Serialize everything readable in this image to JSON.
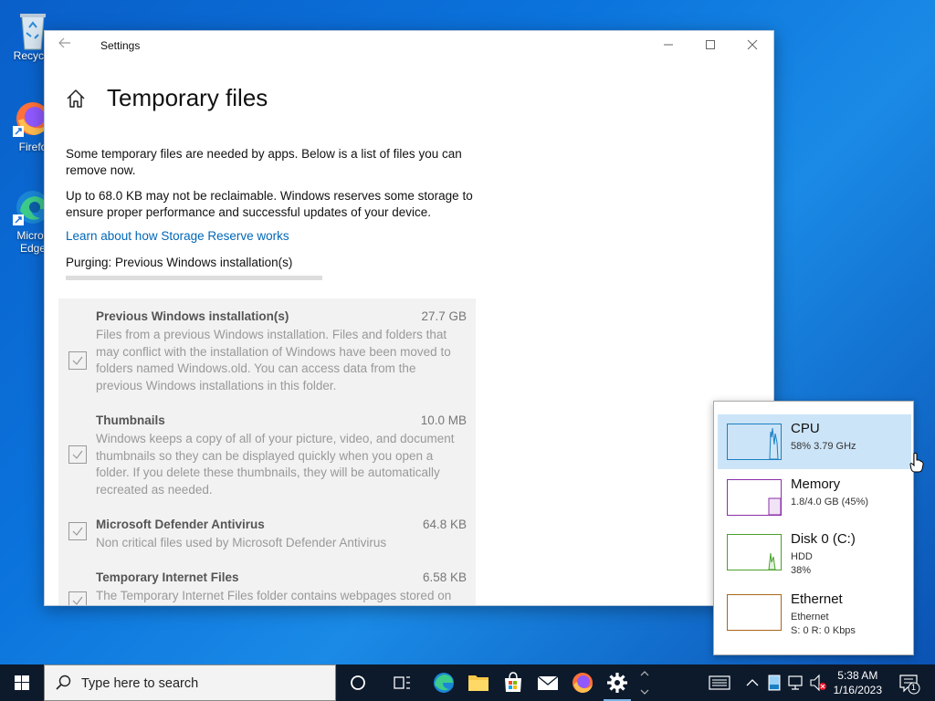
{
  "desktop": {
    "icons": [
      {
        "label": "Recycle"
      },
      {
        "label": "Firefo"
      },
      {
        "label": "Micros",
        "label2": "Edge"
      }
    ]
  },
  "window": {
    "title": "Settings",
    "page_title": "Temporary files",
    "intro": "Some temporary files are needed by apps. Below is a list of files you can remove now.",
    "reserve_text": "Up to 68.0 KB may not be reclaimable. Windows reserves some storage to ensure proper performance and successful updates of your device.",
    "link": "Learn about how Storage Reserve works",
    "purging": "Purging: Previous Windows installation(s)",
    "progress": 0,
    "items": [
      {
        "name": "Previous Windows installation(s)",
        "size": "27.7 GB",
        "checked": true,
        "description": "Files from a previous Windows installation.  Files and folders that may conflict with the installation of Windows have been moved to folders named Windows.old.  You can access data from the previous Windows installations in this folder."
      },
      {
        "name": "Thumbnails",
        "size": "10.0 MB",
        "checked": true,
        "description": "Windows keeps a copy of all of your picture, video, and document thumbnails so they can be displayed quickly when you open a folder. If you delete these thumbnails, they will be automatically recreated as needed."
      },
      {
        "name": "Microsoft Defender Antivirus",
        "size": "64.8 KB",
        "checked": true,
        "description": "Non critical files used by Microsoft Defender Antivirus"
      },
      {
        "name": "Temporary Internet Files",
        "size": "6.58 KB",
        "checked": true,
        "description": "The Temporary Internet Files folder contains webpages stored on"
      }
    ]
  },
  "perf_flyout": {
    "items": [
      {
        "name": "CPU",
        "line1": "58%  3.79 GHz",
        "line2": "",
        "color": "#1a7fc2",
        "selected": true
      },
      {
        "name": "Memory",
        "line1": "1.8/4.0 GB (45%)",
        "line2": "",
        "color": "#8b2fa8",
        "selected": false
      },
      {
        "name": "Disk 0 (C:)",
        "line1": "HDD",
        "line2": "38%",
        "color": "#4aa02c",
        "selected": false
      },
      {
        "name": "Ethernet",
        "line1": "Ethernet",
        "line2": "S: 0  R: 0 Kbps",
        "color": "#a7671b",
        "selected": false
      }
    ]
  },
  "taskbar": {
    "search_placeholder": "Type here to search",
    "time": "5:38 AM",
    "date": "1/16/2023",
    "notification_count": "1",
    "apps": [
      "cortana-icon",
      "task-view-icon",
      "edge-icon",
      "file-explorer-icon",
      "store-icon",
      "mail-icon",
      "firefox-icon",
      "settings-icon"
    ]
  }
}
